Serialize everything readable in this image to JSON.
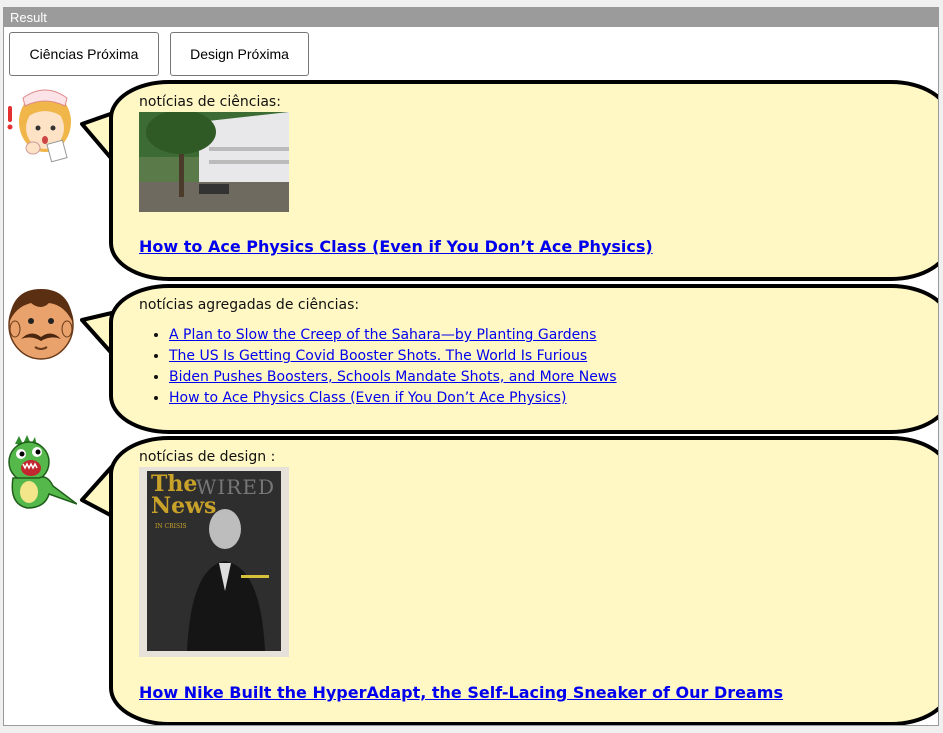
{
  "window": {
    "title": "Result"
  },
  "toolbar": {
    "science_next": "Ciências Próxima",
    "design_next": "Design Próxima"
  },
  "science": {
    "heading": "notícias de ciências:",
    "image_alt": "courtyard-photo",
    "link": "How to Ace Physics Class (Even if You Don’t Ace Physics)"
  },
  "aggregated": {
    "heading": "notícias agregadas de ciências:",
    "items": [
      "A Plan to Slow the Creep of the Sahara—by Planting Gardens",
      "The US Is Getting Covid Booster Shots. The World Is Furious",
      "Biden Pushes Boosters, Schools Mandate Shots, and More News",
      "How to Ace Physics Class (Even if You Don’t Ace Physics)"
    ]
  },
  "design": {
    "heading": "notícias de design :",
    "cover_title": "The News",
    "cover_subtitle": "IN CRISIS",
    "cover_masthead": "WIRED",
    "link": "How Nike Built the HyperAdapt, the Self-Lacing Sneaker of Our Dreams"
  },
  "colors": {
    "bubble": "#fff8c4",
    "link": "#0000ee",
    "titlebar": "#9b9b9b"
  }
}
